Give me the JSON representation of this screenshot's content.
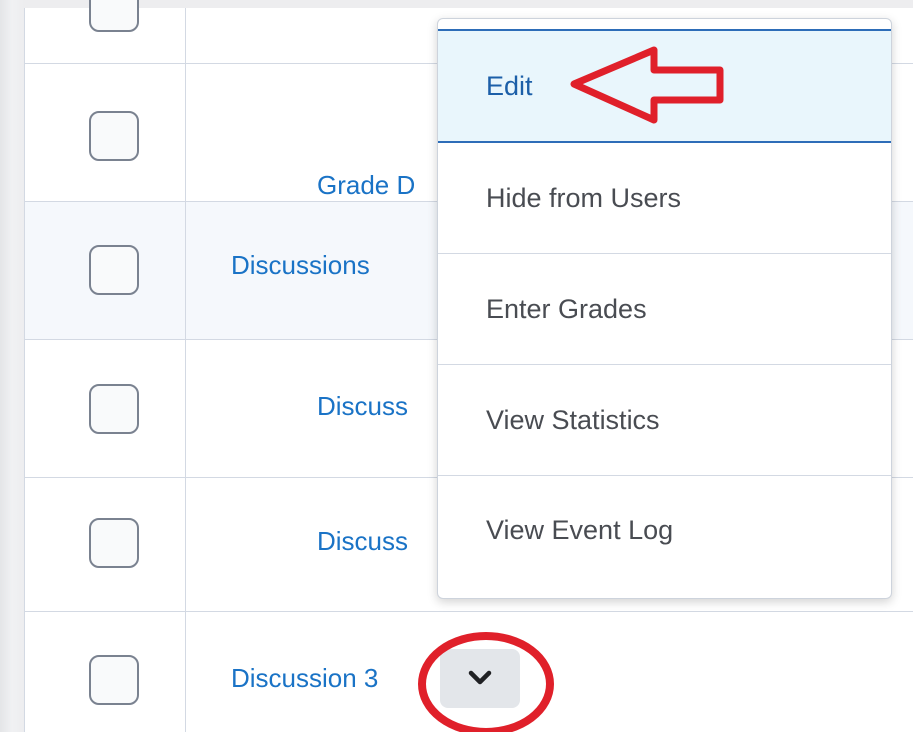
{
  "rows": [
    {
      "label": ""
    },
    {
      "label": "Grade D"
    },
    {
      "label": "Discussions"
    },
    {
      "label": "Discuss"
    },
    {
      "label": "Discuss"
    },
    {
      "label": "Discussion 3"
    }
  ],
  "context_menu": {
    "items": [
      {
        "label": "Edit"
      },
      {
        "label": "Hide from Users"
      },
      {
        "label": "Enter Grades"
      },
      {
        "label": "View Statistics"
      },
      {
        "label": "View Event Log"
      }
    ]
  },
  "annotation_color": "#e0202a",
  "link_color": "#1a73c6"
}
